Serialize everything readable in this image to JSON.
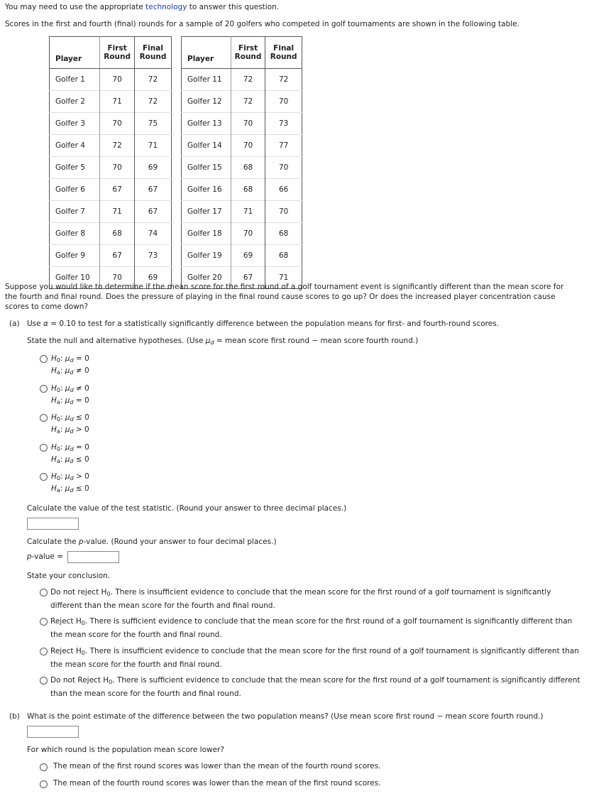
{
  "intro": {
    "prefix": "You may need to use the appropriate ",
    "link": "technology",
    "suffix": " to answer this question."
  },
  "table_caption": "Scores in the first and fourth (final) rounds for a sample of 20 golfers who competed in golf tournaments are shown in the following table.",
  "table": {
    "headers": {
      "player": "Player",
      "first_1": "First",
      "first_2": "Round",
      "final_1": "Final",
      "final_2": "Round"
    },
    "left": [
      {
        "player": "Golfer 1",
        "first": "70",
        "final": "72"
      },
      {
        "player": "Golfer 2",
        "first": "71",
        "final": "72"
      },
      {
        "player": "Golfer 3",
        "first": "70",
        "final": "75"
      },
      {
        "player": "Golfer 4",
        "first": "72",
        "final": "71"
      },
      {
        "player": "Golfer 5",
        "first": "70",
        "final": "69"
      },
      {
        "player": "Golfer 6",
        "first": "67",
        "final": "67"
      },
      {
        "player": "Golfer 7",
        "first": "71",
        "final": "67"
      },
      {
        "player": "Golfer 8",
        "first": "68",
        "final": "74"
      },
      {
        "player": "Golfer 9",
        "first": "67",
        "final": "73"
      },
      {
        "player": "Golfer 10",
        "first": "70",
        "final": "69"
      }
    ],
    "right": [
      {
        "player": "Golfer 11",
        "first": "72",
        "final": "72"
      },
      {
        "player": "Golfer 12",
        "first": "72",
        "final": "70"
      },
      {
        "player": "Golfer 13",
        "first": "70",
        "final": "73"
      },
      {
        "player": "Golfer 14",
        "first": "70",
        "final": "77"
      },
      {
        "player": "Golfer 15",
        "first": "68",
        "final": "70"
      },
      {
        "player": "Golfer 16",
        "first": "68",
        "final": "66"
      },
      {
        "player": "Golfer 17",
        "first": "71",
        "final": "70"
      },
      {
        "player": "Golfer 18",
        "first": "70",
        "final": "68"
      },
      {
        "player": "Golfer 19",
        "first": "69",
        "final": "68"
      },
      {
        "player": "Golfer 20",
        "first": "67",
        "final": "71"
      }
    ]
  },
  "scenario": "Suppose you would like to determine if the mean score for the first round of a golf tournament event is significantly different than the mean score for the fourth and final round. Does the pressure of playing in the final round cause scores to go up? Or does the increased player concentration cause scores to come down?",
  "part_a": {
    "label": "(a)",
    "question_pre": "Use ",
    "alpha": "α",
    "question_post": " = 0.10 to test for a statistically significantly difference between the population means for first- and fourth-round scores.",
    "hyp_instruction_pre": "State the null and alternative hypotheses. (Use ",
    "mu_d": "μ",
    "d": "d",
    "hyp_instruction_post": " = mean score first round − mean score fourth round.)",
    "hypotheses": [
      {
        "h0_op": "= 0",
        "ha_op": "≠ 0"
      },
      {
        "h0_op": "≠ 0",
        "ha_op": "= 0"
      },
      {
        "h0_op": "≤ 0",
        "ha_op": "> 0"
      },
      {
        "h0_op": "= 0",
        "ha_op": "≤ 0"
      },
      {
        "h0_op": "> 0",
        "ha_op": "≤ 0"
      }
    ],
    "h0": "H",
    "h0_sub": "0",
    "ha": "H",
    "ha_sub": "a",
    "test_stat_prompt": "Calculate the value of the test statistic. (Round your answer to three decimal places.)",
    "test_stat_value": "",
    "pvalue_prompt_pre": "Calculate the ",
    "pvalue_p": "p",
    "pvalue_prompt_post": "-value. (Round your answer to four decimal places.)",
    "pvalue_label_p": "p",
    "pvalue_label_rest": "-value =",
    "pvalue_value": "",
    "conclusion_prompt": "State your conclusion.",
    "conclusions": [
      {
        "lead": "Do not reject H",
        "rest": ". There is insufficient evidence to conclude that the mean score for the first round of a golf tournament is significantly different than the mean score for the fourth and final round."
      },
      {
        "lead": "Reject H",
        "rest": ". There is sufficient evidence to conclude that the mean score for the first round of a golf tournament is significantly different than the mean score for the fourth and final round."
      },
      {
        "lead": "Reject H",
        "rest": ". There is insufficient evidence to conclude that the mean score for the first round of a golf tournament is significantly different than the mean score for the fourth and final round."
      },
      {
        "lead": "Do not Reject H",
        "rest": ". There is sufficient evidence to conclude that the mean score for the first round of a golf tournament is significantly different than the mean score for the fourth and final round."
      }
    ]
  },
  "part_b": {
    "label": "(b)",
    "question": "What is the point estimate of the difference between the two population means? (Use mean score first round − mean score fourth round.)",
    "estimate_value": "",
    "lower_prompt": "For which round is the population mean score lower?",
    "options": [
      "The mean of the first round scores was lower than the mean of the fourth round scores.",
      "The mean of the fourth round scores was lower than the mean of the first round scores."
    ]
  }
}
